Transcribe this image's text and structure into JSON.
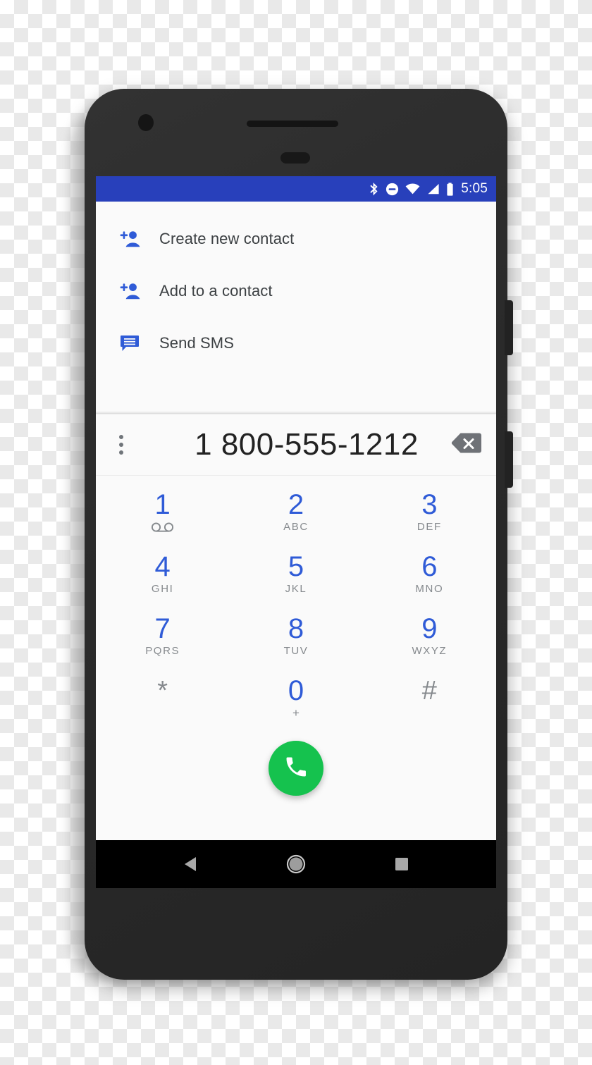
{
  "device": {
    "type": "android-phone-mockup",
    "body_color": "#2c2c2c"
  },
  "status_bar": {
    "background": "#2840bb",
    "time": "5:05",
    "icons": [
      "bluetooth-icon",
      "do-not-disturb-icon",
      "wifi-icon",
      "cellular-signal-icon",
      "battery-icon"
    ]
  },
  "action_menu": {
    "items": [
      {
        "label": "Create new contact",
        "icon": "person-add-icon"
      },
      {
        "label": "Add to a contact",
        "icon": "person-add-icon"
      },
      {
        "label": "Send SMS",
        "icon": "message-icon"
      }
    ],
    "accent_color": "#2f5bd7"
  },
  "number_row": {
    "number": "1 800-555-1212",
    "overflow_icon": "more-vert-icon",
    "backspace_icon": "backspace-icon"
  },
  "dialpad": {
    "keys": [
      {
        "digit": "1",
        "sub": "",
        "icon": "voicemail-icon",
        "muted": false
      },
      {
        "digit": "2",
        "sub": "ABC",
        "icon": "",
        "muted": false
      },
      {
        "digit": "3",
        "sub": "DEF",
        "icon": "",
        "muted": false
      },
      {
        "digit": "4",
        "sub": "GHI",
        "icon": "",
        "muted": false
      },
      {
        "digit": "5",
        "sub": "JKL",
        "icon": "",
        "muted": false
      },
      {
        "digit": "6",
        "sub": "MNO",
        "icon": "",
        "muted": false
      },
      {
        "digit": "7",
        "sub": "PQRS",
        "icon": "",
        "muted": false
      },
      {
        "digit": "8",
        "sub": "TUV",
        "icon": "",
        "muted": false
      },
      {
        "digit": "9",
        "sub": "WXYZ",
        "icon": "",
        "muted": false
      },
      {
        "digit": "*",
        "sub": "",
        "icon": "",
        "muted": true
      },
      {
        "digit": "0",
        "sub": "+",
        "icon": "",
        "muted": false
      },
      {
        "digit": "#",
        "sub": "",
        "icon": "",
        "muted": true
      }
    ],
    "digit_color": "#2f5bd7",
    "letters_color": "#85898d"
  },
  "call_button": {
    "icon": "phone-call-icon",
    "color": "#15c24e"
  },
  "nav_bar": {
    "background": "#000000",
    "buttons": [
      {
        "name": "back",
        "icon": "back-triangle-icon"
      },
      {
        "name": "home",
        "icon": "home-circle-icon"
      },
      {
        "name": "recents",
        "icon": "recents-square-icon"
      }
    ]
  }
}
